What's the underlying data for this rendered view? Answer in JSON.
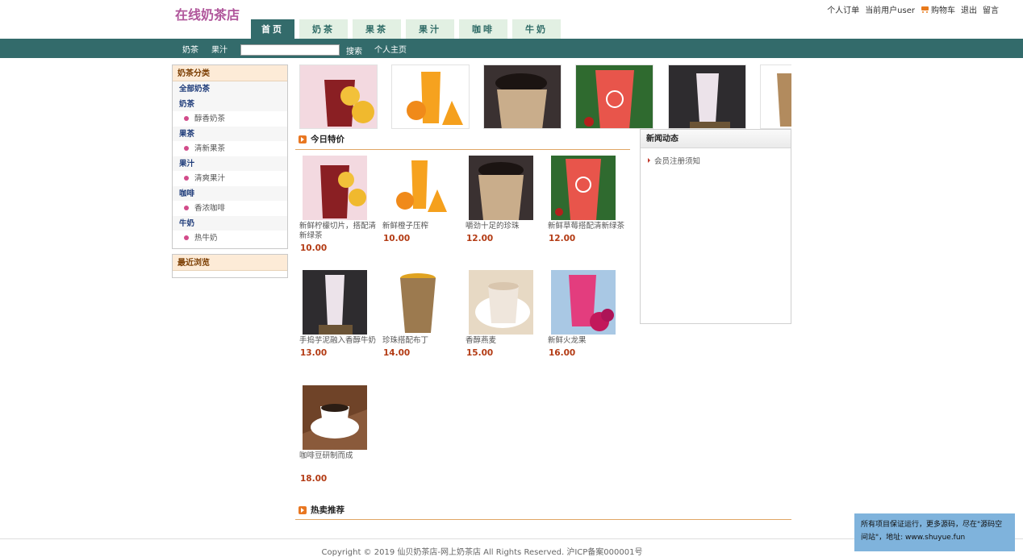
{
  "site": {
    "logo": "在线奶茶店"
  },
  "top_links": {
    "orders": "个人订单",
    "user": "当前用户user",
    "cart": "购物车",
    "logout": "退出",
    "message": "留言"
  },
  "tabs": [
    "首页",
    "奶茶",
    "果茶",
    "果汁",
    "咖啡",
    "牛奶"
  ],
  "navbar": {
    "item1": "奶茶",
    "item2": "果汁",
    "search_value": "",
    "search_button": "搜索",
    "profile": "个人主页"
  },
  "sidebar": {
    "category_title": "奶茶分类",
    "rows": [
      {
        "label": "全部奶茶",
        "kind": "top"
      },
      {
        "label": "奶茶",
        "kind": "top"
      },
      {
        "label": "醇香奶茶",
        "kind": "sub"
      },
      {
        "label": "果茶",
        "kind": "top"
      },
      {
        "label": "清新果茶",
        "kind": "sub"
      },
      {
        "label": "果汁",
        "kind": "top"
      },
      {
        "label": "清爽果汁",
        "kind": "sub"
      },
      {
        "label": "咖啡",
        "kind": "top"
      },
      {
        "label": "香浓咖啡",
        "kind": "sub"
      },
      {
        "label": "牛奶",
        "kind": "top"
      },
      {
        "label": "热牛奶",
        "kind": "sub"
      }
    ],
    "recent_title": "最近浏览"
  },
  "sections": {
    "special": "今日特价",
    "hot": "热卖推荐"
  },
  "products": [
    {
      "name": "新鲜柠檬切片，搭配清新绿茶",
      "price": "10.00",
      "img": "fruit-tea"
    },
    {
      "name": "新鲜橙子压榨",
      "price": "10.00",
      "img": "orange-juice"
    },
    {
      "name": "嚼劲十足的珍珠",
      "price": "12.00",
      "img": "pearl-milk-tea"
    },
    {
      "name": "新鲜草莓搭配清新绿茶",
      "price": "12.00",
      "img": "strawberry-tea"
    },
    {
      "name": "手捣芋泥融入香醇牛奶",
      "price": "13.00",
      "img": "taro-milk"
    },
    {
      "name": "珍珠搭配布丁",
      "price": "14.00",
      "img": "pudding-tea"
    },
    {
      "name": "香醇燕麦",
      "price": "15.00",
      "img": "oat-milk"
    },
    {
      "name": "新鲜火龙果",
      "price": "16.00",
      "img": "dragon-fruit"
    },
    {
      "name": "咖啡豆研制而成",
      "price": "18.00",
      "img": "coffee"
    }
  ],
  "news": {
    "title": "新闻动态",
    "items": [
      "会员注册须知"
    ]
  },
  "footer": {
    "text": "Copyright © 2019 仙贝奶茶店-网上奶茶店 All Rights Reserved. 沪ICP备案000001号"
  },
  "notice": {
    "text": "所有项目保证运行，更多源码，尽在\"源码空间站\"，地址: www.shuyue.fun"
  }
}
